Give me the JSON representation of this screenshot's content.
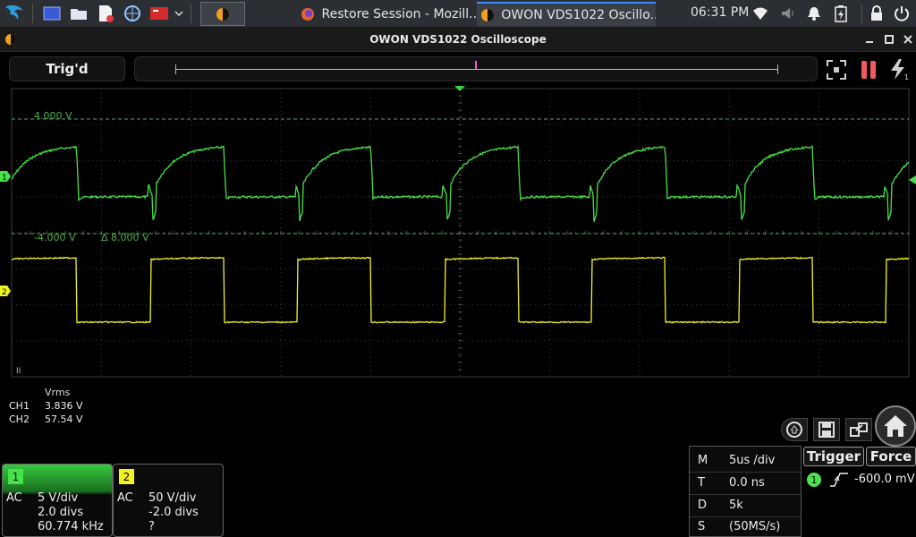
{
  "taskbar": {
    "tasks": [
      {
        "label": "Restore Session - Mozill...",
        "icon": "firefox-icon"
      },
      {
        "label": "OWON VDS1022 Oscillo...",
        "icon": "owon-app-icon"
      }
    ],
    "clock": "06:31 PM"
  },
  "window": {
    "title": "OWON VDS1022 Oscilloscope"
  },
  "toolbar": {
    "trigger_status": "Trig'd"
  },
  "screen": {
    "ch1_upper_cursor": "4.000 V",
    "ch1_lower_cursor": "-4.000 V",
    "cursor_delta": "Δ 8.000 V",
    "ch1_marker": "1",
    "ch2_marker": "2",
    "bottom_left_marker": "II",
    "colors": {
      "ch1": "#46e24a",
      "ch2": "#f3f321",
      "grid": "#3a3a3a",
      "cursor": "#4fae4f",
      "trigger_marker": "#39d43d"
    }
  },
  "measurements": {
    "header": "Vrms",
    "rows": [
      {
        "channel": "CH1",
        "value": "3.836 V"
      },
      {
        "channel": "CH2",
        "value": "57.54 V"
      }
    ]
  },
  "channels": [
    {
      "number": "1",
      "coupling": "AC",
      "volts_div": "5 V/div",
      "offset": "2.0 divs",
      "freq": "60.774 kHz",
      "color": "#46e24a"
    },
    {
      "number": "2",
      "coupling": "AC",
      "volts_div": "50 V/div",
      "offset": "-2.0 divs",
      "freq": "?",
      "color": "#f3f321"
    }
  ],
  "timebase": {
    "rows": [
      {
        "key": "M",
        "value": "5us /div"
      },
      {
        "key": "T",
        "value": "0.0 ns"
      },
      {
        "key": "D",
        "value": "5k"
      },
      {
        "key": "S",
        "value": "(50MS/s)"
      }
    ]
  },
  "trigger": {
    "trigger_label": "Trigger",
    "force_label": "Force",
    "source": "1",
    "level": "-600.0 mV"
  }
}
